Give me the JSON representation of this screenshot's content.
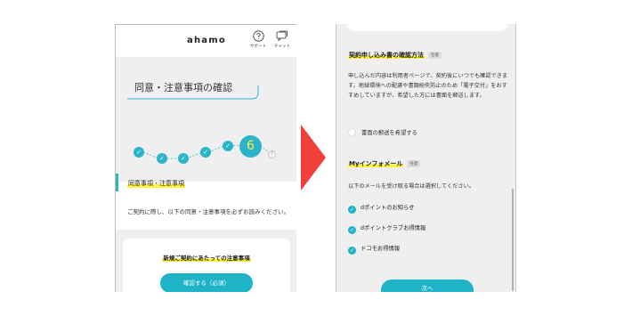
{
  "left": {
    "logo": "ahamo",
    "support_label": "サポート",
    "chat_label": "チャット",
    "page_title": "同意・注意事項の確認",
    "steps": {
      "done": [
        "✓",
        "✓",
        "✓",
        "✓",
        "✓"
      ],
      "current": "6",
      "next": "7"
    },
    "section_title": "同意事項・注意事項",
    "intro": "ご契約に際し、以下の同意・注意事項を必ずお読みください。",
    "notice_title": "新規ご契約にあたっての注意事項",
    "confirm_button": "確認する（必須）"
  },
  "right": {
    "confirm_method": {
      "title": "契約申し込み書の確認方法",
      "badge": "任意",
      "description": "申し込んだ内容は利用者ページで、契約後にいつでも確認できます。地球環境への配慮や書類紛失防止のため「電子交付」をおすすめしていますが、希望した方には書面を郵送します。",
      "radio_label": "書面の郵送を希望する"
    },
    "my_info": {
      "title": "Myインフォメール",
      "badge": "任意",
      "description": "以下のメールを受け取る場合は選択してください。",
      "options": [
        "dポイントのお知らせ",
        "dポイントクラブお得情報",
        "ドコモお得情報"
      ]
    },
    "next_button": "次へ"
  },
  "colors": {
    "accent": "#2bb3c7",
    "highlight": "#fff23a",
    "arrow": "#f1403a",
    "gray_bg": "#efefef"
  }
}
